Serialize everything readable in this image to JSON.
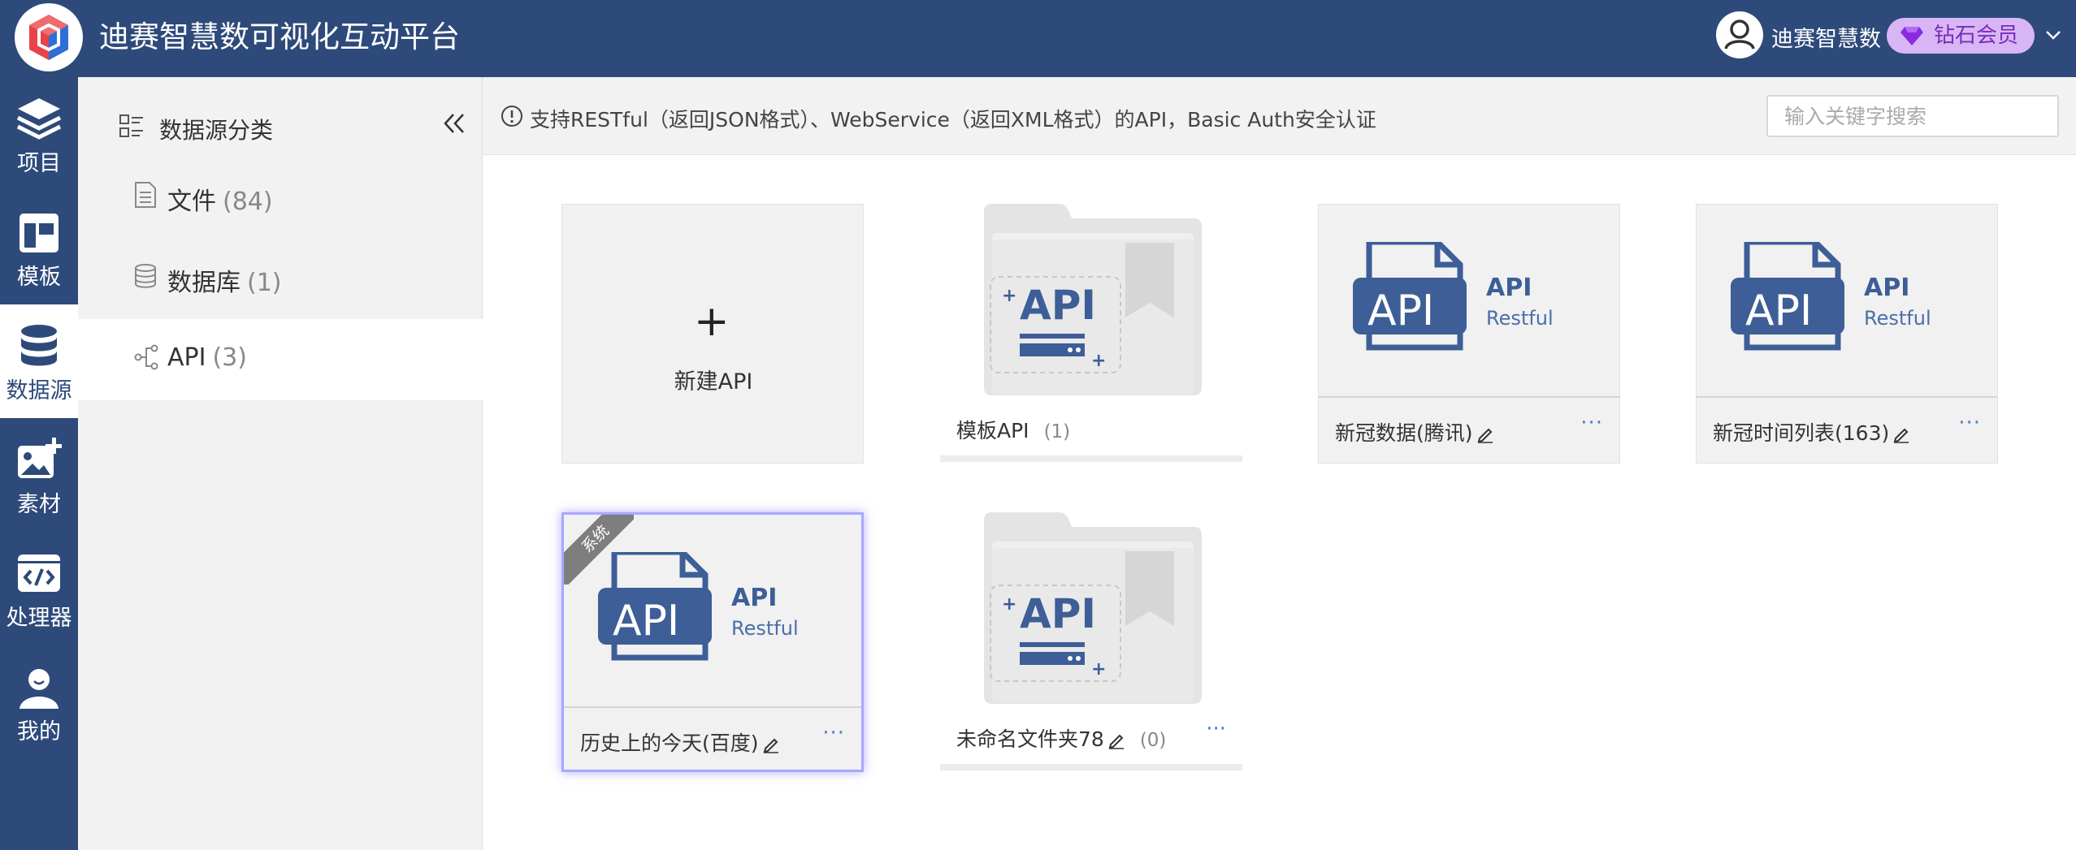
{
  "header": {
    "app_title": "迪赛智慧数可视化互动平台",
    "user_name": "迪赛智慧数",
    "vip_label": "钻石会员",
    "vip_color": "#d8b6f5"
  },
  "rail": {
    "items": [
      {
        "label": "项目",
        "icon": "layers-icon"
      },
      {
        "label": "模板",
        "icon": "template-icon"
      },
      {
        "label": "数据源",
        "icon": "database-icon",
        "active": true
      },
      {
        "label": "素材",
        "icon": "image-add-icon"
      },
      {
        "label": "处理器",
        "icon": "code-icon"
      },
      {
        "label": "我的",
        "icon": "user-icon"
      }
    ]
  },
  "categories": {
    "title": "数据源分类",
    "items": [
      {
        "label": "文件",
        "count": "(84)",
        "icon": "file-icon"
      },
      {
        "label": "数据库",
        "count": "(1)",
        "icon": "database-small-icon"
      },
      {
        "label": "API",
        "count": "(3)",
        "icon": "api-node-icon",
        "active": true
      }
    ]
  },
  "infobar": {
    "text": "支持RESTful（返回JSON格式）、WebService（返回XML格式）的API，Basic Auth安全认证",
    "search_placeholder": "输入关键字搜索"
  },
  "cards": {
    "new_label": "新建API",
    "new_plus": "+",
    "template_folder": {
      "name": "模板API",
      "count": "(1)"
    },
    "api1": {
      "name": "新冠数据(腾讯)",
      "more": "···"
    },
    "api2": {
      "name": "新冠时间列表(163)",
      "more": "···"
    },
    "api3": {
      "name": "历史上的今天(百度)",
      "more": "···",
      "ribbon": "系统"
    },
    "folder2": {
      "name": "未命名文件夹78",
      "count": "(0)",
      "more": "···"
    },
    "api_badge_title": "API",
    "api_badge_sub": "Restful",
    "folder_api_text": "API"
  },
  "colors": {
    "primary": "#2d4a7a",
    "link": "#4a7bd0",
    "api_blue": "#3d5e97"
  }
}
